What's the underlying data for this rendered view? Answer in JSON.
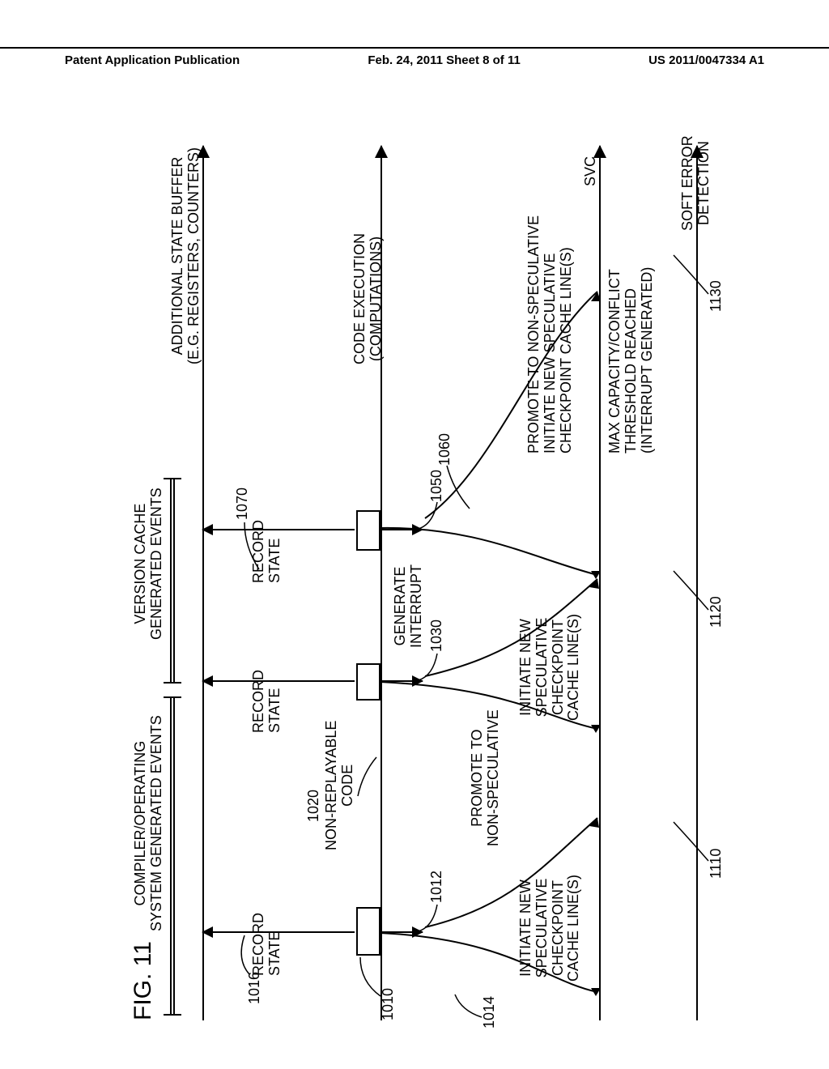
{
  "header": {
    "left": "Patent Application Publication",
    "center": "Feb. 24, 2011  Sheet 8 of 11",
    "right": "US 2011/0047334 A1"
  },
  "fig_label": "FIG. 11",
  "row": {
    "additional_state": {
      "title": "ADDITIONAL STATE BUFFER\n(E.G. REGISTERS, COUNTERS)"
    },
    "code_exec": {
      "title": "CODE EXECUTION\n(COMPUTATIONS)"
    },
    "svc": {
      "title": "SVC"
    },
    "soft_err": {
      "title": "SOFT ERROR\nDETECTION"
    },
    "compiler": {
      "title": "COMPILER/OPERATING\nSYSTEM GENERATED EVENTS"
    },
    "version_cache": {
      "title": "VERSION CACHE\nGENERATED EVENTS"
    }
  },
  "labels": {
    "record_state": "RECORD\nSTATE",
    "generate_interrupt": "GENERATE\nINTERRUPT",
    "non_replayable": "NON-REPLAYABLE\nCODE",
    "promote_non_spec": "PROMOTE TO\nNON-SPECULATIVE",
    "init_spec_cp": "INITIATE NEW\nSPECULATIVE\nCHECKPOINT\nCACHE LINE(S)",
    "promote_full": "PROMOTE TO NON-SPECULATIVE\nINITIATE NEW SPECULATIVE\nCHECKPOINT CACHE LINE(S)",
    "max_cap": "MAX CAPACITY/CONFLICT\nTHRESHOLD REACHED\n(INTERRUPT GENERATED)"
  },
  "ref": {
    "r1010": "1010",
    "r1012": "1012",
    "r1014": "1014",
    "r1016": "1016",
    "r1020": "1020",
    "r1030": "1030",
    "r1050": "1050",
    "r1060": "1060",
    "r1070": "1070",
    "r1110": "1110",
    "r1120": "1120",
    "r1130": "1130"
  }
}
